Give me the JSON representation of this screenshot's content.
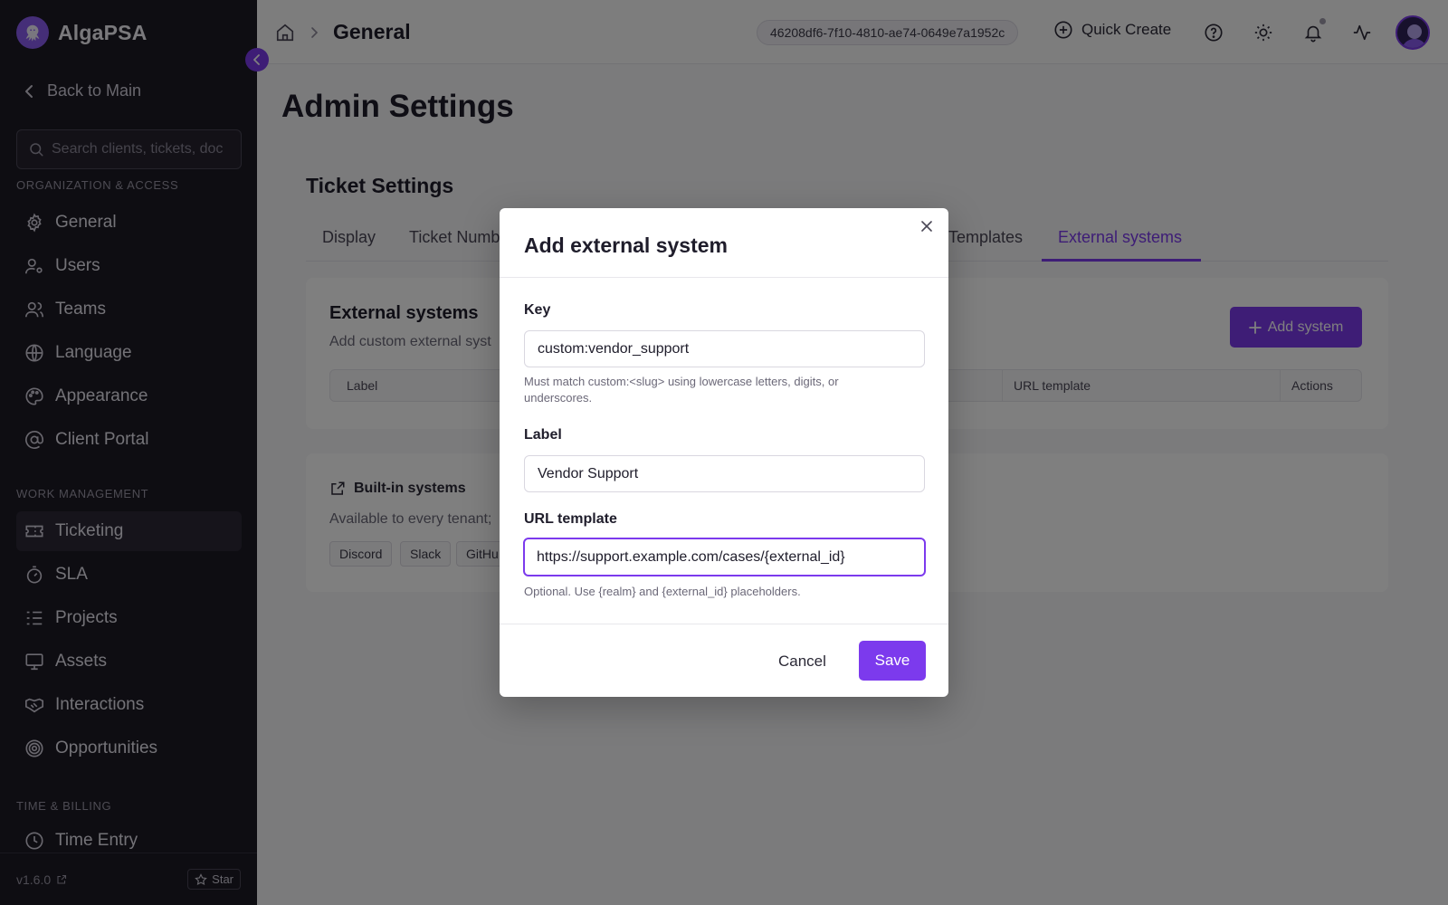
{
  "app": {
    "name": "AlgaPSA"
  },
  "sidebar": {
    "back_label": "Back to Main",
    "search_placeholder": "Search clients, tickets, doc",
    "sections": {
      "org": "ORGANIZATION & ACCESS",
      "work": "WORK MANAGEMENT",
      "billing": "TIME & BILLING"
    },
    "items": {
      "general": "General",
      "users": "Users",
      "teams": "Teams",
      "language": "Language",
      "appearance": "Appearance",
      "client_portal": "Client Portal",
      "ticketing": "Ticketing",
      "sla": "SLA",
      "projects": "Projects",
      "assets": "Assets",
      "interactions": "Interactions",
      "opportunities": "Opportunities",
      "time_entry": "Time Entry"
    },
    "active_item": "Ticketing",
    "version": "v1.6.0",
    "star_label": "Star"
  },
  "topbar": {
    "breadcrumb": "General",
    "tenant_id": "46208df6-7f10-4810-ae74-0649e7a1952c",
    "quick_create": "Quick Create"
  },
  "page": {
    "title": "Admin Settings",
    "section_title": "Ticket Settings",
    "tabs": {
      "display": "Display",
      "ticket_numbering": "Ticket Numb",
      "templates": "Templates",
      "external_systems": "External systems"
    },
    "active_tab": "External systems",
    "external": {
      "title": "External systems",
      "subtitle": "Add custom external syst",
      "add_button": "Add system",
      "columns": {
        "label": "Label",
        "url_template": "URL template",
        "actions": "Actions"
      }
    },
    "builtin": {
      "title": "Built-in systems",
      "subtitle": "Available to every tenant;",
      "chips": [
        "Discord",
        "Slack",
        "GitHu"
      ]
    }
  },
  "modal": {
    "title": "Add external system",
    "key": {
      "label": "Key",
      "value": "custom:vendor_support",
      "hint": "Must match custom:<slug> using lowercase letters, digits, or underscores."
    },
    "label_field": {
      "label": "Label",
      "value": "Vendor Support"
    },
    "url_template": {
      "label": "URL template",
      "value": "https://support.example.com/cases/{external_id}",
      "hint": "Optional. Use {realm} and {external_id} placeholders."
    },
    "cancel_label": "Cancel",
    "save_label": "Save"
  },
  "colors": {
    "accent": "#7c3aed",
    "sidebar_bg": "#1c1a24",
    "overlay": "rgba(0,0,0,0.5)"
  }
}
